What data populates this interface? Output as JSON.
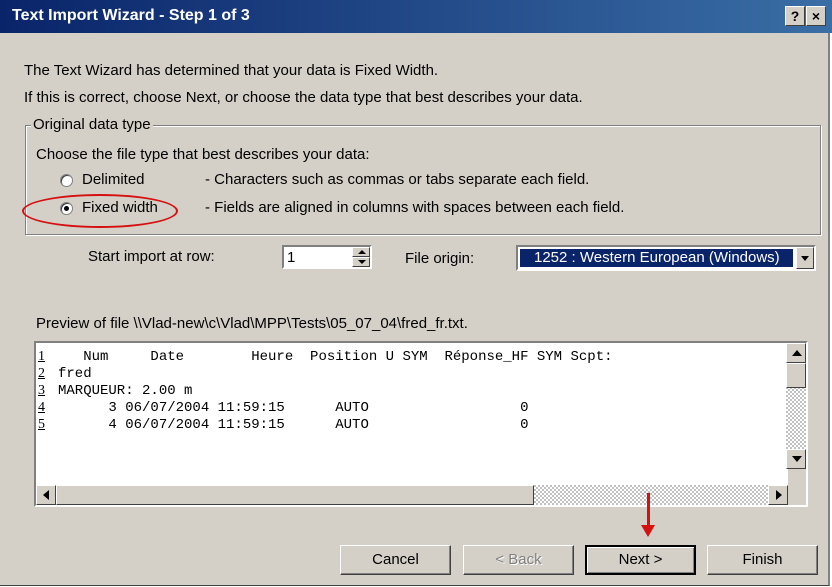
{
  "window": {
    "title": "Text Import Wizard - Step 1 of 3",
    "help_glyph": "?",
    "close_glyph": "×"
  },
  "intro": {
    "line1": "The Text Wizard has determined that your data is Fixed Width.",
    "line2": "If this is correct, choose Next, or choose the data type that best describes your data."
  },
  "original_data_type": {
    "legend": "Original data type",
    "prompt": "Choose the file type that best describes your data:",
    "options": [
      {
        "label": "Delimited",
        "description": "- Characters such as commas or tabs separate each field.",
        "selected": false
      },
      {
        "label": "Fixed width",
        "description": "- Fields are aligned in columns with spaces between each field.",
        "selected": true
      }
    ]
  },
  "start_import": {
    "label": "Start import at row:",
    "value": "1"
  },
  "file_origin": {
    "label": "File origin:",
    "value": "1252 : Western European (Windows)"
  },
  "preview": {
    "label": "Preview of file \\\\Vlad-new\\c\\Vlad\\MPP\\Tests\\05_07_04\\fred_fr.txt.",
    "row_numbers": [
      "1",
      "2",
      "3",
      "4",
      "5"
    ],
    "lines": [
      "   Num     Date        Heure  Position U SYM  Réponse_HF SYM Scpt:",
      "fred",
      "MARQUEUR: 2.00 m",
      "      3 06/07/2004 11:59:15      AUTO                  0",
      "      4 06/07/2004 11:59:15      AUTO                  0"
    ]
  },
  "buttons": {
    "cancel": "Cancel",
    "back": "< Back",
    "next": "Next >",
    "finish": "Finish"
  },
  "annotation_color": "#d41010"
}
